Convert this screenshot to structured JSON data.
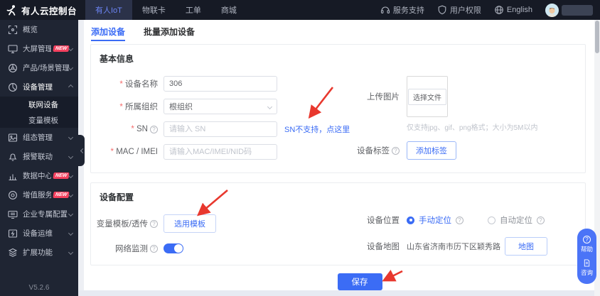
{
  "header": {
    "logo_title": "有人云控制台",
    "nav": [
      {
        "label": "有人IoT"
      },
      {
        "label": "物联卡"
      },
      {
        "label": "工单"
      },
      {
        "label": "商城"
      }
    ],
    "right": [
      {
        "label": "服务支持"
      },
      {
        "label": "用户权限"
      },
      {
        "label": "English"
      }
    ]
  },
  "sidebar": {
    "items": [
      {
        "label": "概览"
      },
      {
        "label": "大屏管理",
        "badge": "NEW"
      },
      {
        "label": "产品/场景管理"
      },
      {
        "label": "设备管理",
        "children": [
          {
            "label": "联网设备"
          },
          {
            "label": "变量模板"
          }
        ]
      },
      {
        "label": "组态管理"
      },
      {
        "label": "报警联动"
      },
      {
        "label": "数据中心",
        "badge": "NEW"
      },
      {
        "label": "增值服务",
        "badge": "NEW"
      },
      {
        "label": "企业专属配置"
      },
      {
        "label": "设备运维"
      },
      {
        "label": "扩展功能"
      }
    ],
    "version": "V5.2.6"
  },
  "tabs": [
    {
      "label": "添加设备"
    },
    {
      "label": "批量添加设备"
    }
  ],
  "basic_info": {
    "title": "基本信息",
    "device_name": {
      "label": "设备名称",
      "value": "306"
    },
    "organization": {
      "label": "所属组织",
      "value": "根组织"
    },
    "sn": {
      "label": "SN",
      "placeholder": "请输入 SN",
      "link": "SN不支持，点这里"
    },
    "mac": {
      "label": "MAC / IMEI",
      "placeholder": "请输入MAC/IMEI/NID码"
    },
    "upload": {
      "label": "上传图片",
      "button": "选择文件",
      "hint": "仅支持jpg、gif、png格式；大小为5M以内"
    },
    "tags": {
      "label": "设备标签",
      "button": "添加标签"
    }
  },
  "device_config": {
    "title": "设备配置",
    "template": {
      "label": "变量模板/透传",
      "button": "选用模板"
    },
    "network": {
      "label": "网络监测",
      "enabled": true
    },
    "location": {
      "label": "设备位置",
      "manual": "手动定位",
      "auto": "自动定位"
    },
    "map": {
      "label": "设备地图",
      "address": "山东省济南市历下区颖秀路",
      "button": "地图"
    }
  },
  "save_label": "保存",
  "float_buttons": {
    "help": "帮助",
    "consult": "咨询"
  },
  "colors": {
    "accent": "#3b6cf5",
    "badge": "#f4415f",
    "arrow": "#e8382e"
  }
}
